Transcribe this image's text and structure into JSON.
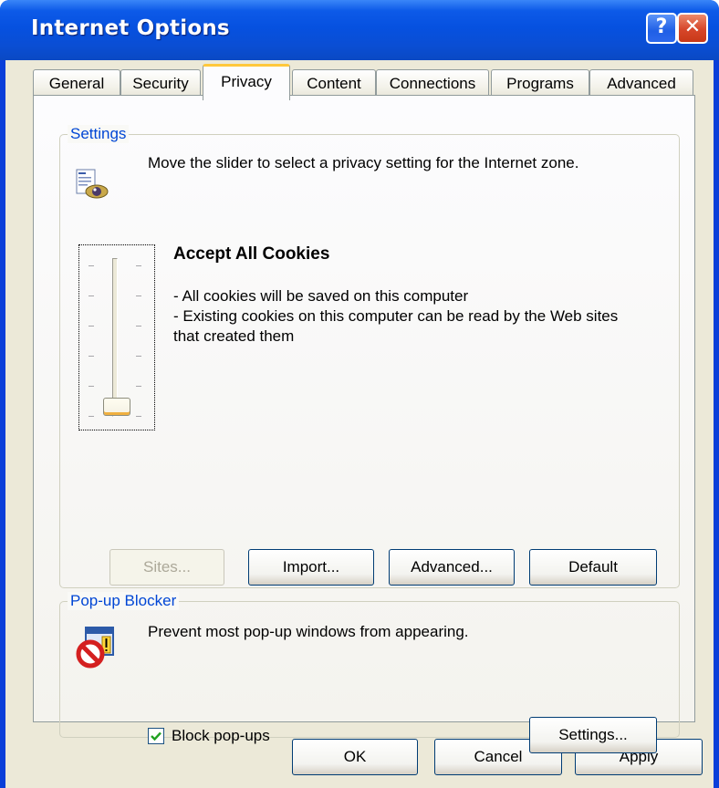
{
  "window": {
    "title": "Internet Options",
    "help_glyph": "?",
    "close_glyph": "✕"
  },
  "tabs": [
    {
      "label": "General",
      "selected": false
    },
    {
      "label": "Security",
      "selected": false
    },
    {
      "label": "Privacy",
      "selected": true
    },
    {
      "label": "Content",
      "selected": false
    },
    {
      "label": "Connections",
      "selected": false
    },
    {
      "label": "Programs",
      "selected": false
    },
    {
      "label": "Advanced",
      "selected": false
    }
  ],
  "settings": {
    "legend": "Settings",
    "icon": "privacy-eye-icon",
    "description": "Move the slider to select a privacy setting for the Internet zone.",
    "slider_level": 0,
    "slider_levels_total": 6,
    "level_title": "Accept All Cookies",
    "level_line1": "- All cookies will be saved on this computer",
    "level_line2": "- Existing cookies on this computer can be read by the Web sites that created them",
    "buttons": {
      "sites": "Sites...",
      "import": "Import...",
      "advanced": "Advanced...",
      "default": "Default"
    }
  },
  "popup_blocker": {
    "legend": "Pop-up Blocker",
    "icon": "popup-blocker-icon",
    "description": "Prevent most pop-up windows from appearing.",
    "checkbox_label": "Block pop-ups",
    "checked": true,
    "settings_button": "Settings..."
  },
  "dialog_buttons": {
    "ok": "OK",
    "cancel": "Cancel",
    "apply": "Apply"
  },
  "colors": {
    "titlebar": "#0a4ed4",
    "dialog_face": "#ece9d8",
    "legend_text": "#0046d5",
    "selected_tab_accent": "#ffc83c"
  }
}
